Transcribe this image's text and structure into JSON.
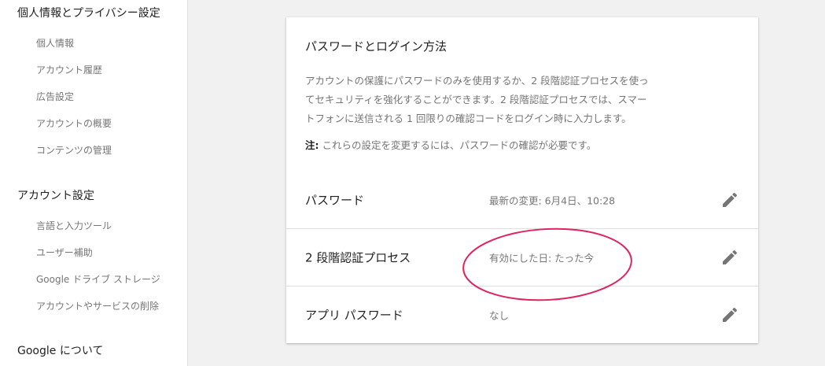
{
  "sidebar": {
    "sections": [
      {
        "title": "個人情報とプライバシー設定",
        "items": [
          "個人情報",
          "アカウント履歴",
          "広告設定",
          "アカウントの概要",
          "コンテンツの管理"
        ]
      },
      {
        "title": "アカウント設定",
        "items": [
          "言語と入力ツール",
          "ユーザー補助",
          "Google ドライブ ストレージ",
          "アカウントやサービスの削除"
        ]
      },
      {
        "title": "Google について",
        "items": []
      }
    ]
  },
  "card": {
    "title": "パスワードとログイン方法",
    "description_lines": [
      "アカウントの保護にパスワードのみを使用するか、2 段階認証プロセスを使っ",
      "てセキュリティを強化することができます。2 段階認証プロセスでは、スマー",
      "トフォンに送信される 1 回限りの確認コードをログイン時に入力します。"
    ],
    "note_label": "注:",
    "note_text": " これらの設定を変更するには、パスワードの確認が必要です。",
    "rows": [
      {
        "label": "パスワード",
        "value": "最新の変更: 6月4日、10:28",
        "icon": "edit-pencil-icon"
      },
      {
        "label": "2 段階認証プロセス",
        "value": "有効にした日: たった今",
        "icon": "edit-pencil-icon"
      },
      {
        "label": "アプリ パスワード",
        "value": "なし",
        "icon": "edit-pencil-icon"
      }
    ]
  },
  "colors": {
    "annotation_circle": "#e0245e",
    "icon": "#757575"
  }
}
